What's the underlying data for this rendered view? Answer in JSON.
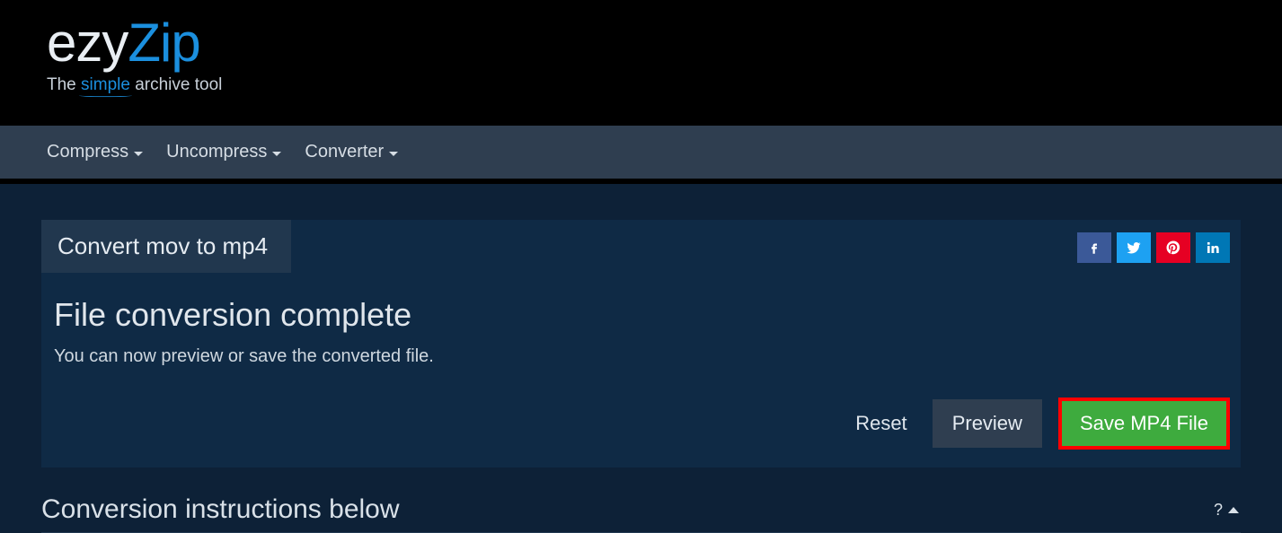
{
  "logo": {
    "part1": "ezy",
    "part2": "Zip"
  },
  "tagline": {
    "pre": "The ",
    "mid": "simple",
    "post": " archive tool"
  },
  "nav": {
    "compress": "Compress",
    "uncompress": "Uncompress",
    "converter": "Converter"
  },
  "tab": {
    "active": "Convert mov to mp4"
  },
  "status": {
    "title": "File conversion complete",
    "subtitle": "You can now preview or save the converted file."
  },
  "actions": {
    "reset": "Reset",
    "preview": "Preview",
    "save": "Save MP4 File"
  },
  "instructions": {
    "title": "Conversion instructions below",
    "help_label": "?"
  },
  "social": {
    "facebook": "facebook",
    "twitter": "twitter",
    "pinterest": "pinterest",
    "linkedin": "linkedin"
  }
}
